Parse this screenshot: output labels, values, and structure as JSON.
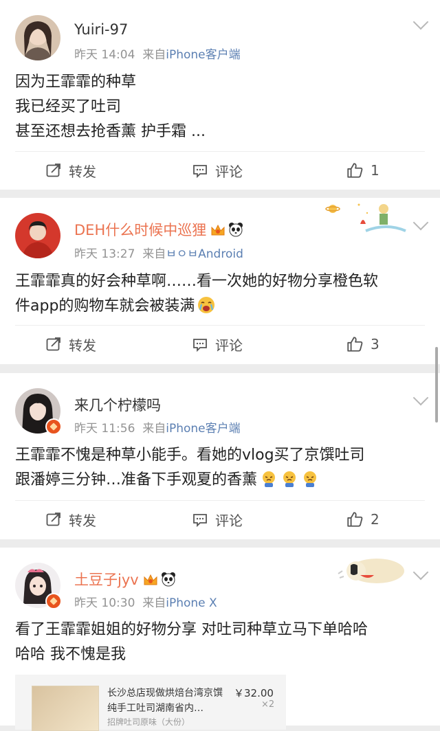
{
  "posts": [
    {
      "name": "Yuiri-97",
      "time": "昨天 14:04",
      "source_prefix": "来自",
      "source": "iPhone客户端",
      "lines": [
        "因为王霏霏的种草",
        "我已经买了吐司",
        "甚至还想去抢香薰 护手霜 ..."
      ],
      "repost_label": "转发",
      "comment_label": "评论",
      "likes": "1"
    },
    {
      "name": "DEH什么时候中巡狸",
      "time": "昨天 13:27",
      "source_prefix": "来自",
      "source": "ㅂㅇㅂAndroid",
      "lines": [
        "王霏霏真的好会种草啊……看一次她的好物分享橙色软",
        "件app的购物车就会被装满"
      ],
      "repost_label": "转发",
      "comment_label": "评论",
      "likes": "3"
    },
    {
      "name": "来几个柠檬吗",
      "time": "昨天 11:56",
      "source_prefix": "来自",
      "source": "iPhone客户端",
      "lines": [
        "王霏霏不愧是种草小能手。看她的vlog买了京馔吐司",
        "跟潘婷三分钟…准备下手观夏的香薰"
      ],
      "repost_label": "转发",
      "comment_label": "评论",
      "likes": "2"
    },
    {
      "name": "土豆子jyv",
      "time": "昨天 10:30",
      "source_prefix": "来自",
      "source": "iPhone X",
      "lines": [
        "看了王霏霏姐姐的好物分享 对吐司种草立马下单哈哈",
        "哈哈 我不愧是我"
      ],
      "product": {
        "title": "长沙总店现做烘焙台湾京馔纯手工吐司湖南省内…",
        "subtitle": "招牌吐司原味（大份）",
        "price": "￥32.00",
        "qty": "×2"
      }
    }
  ],
  "colors": {
    "vip_name": "#eb7350",
    "source_link": "#5b7fb2",
    "badge": "#e8541e"
  }
}
